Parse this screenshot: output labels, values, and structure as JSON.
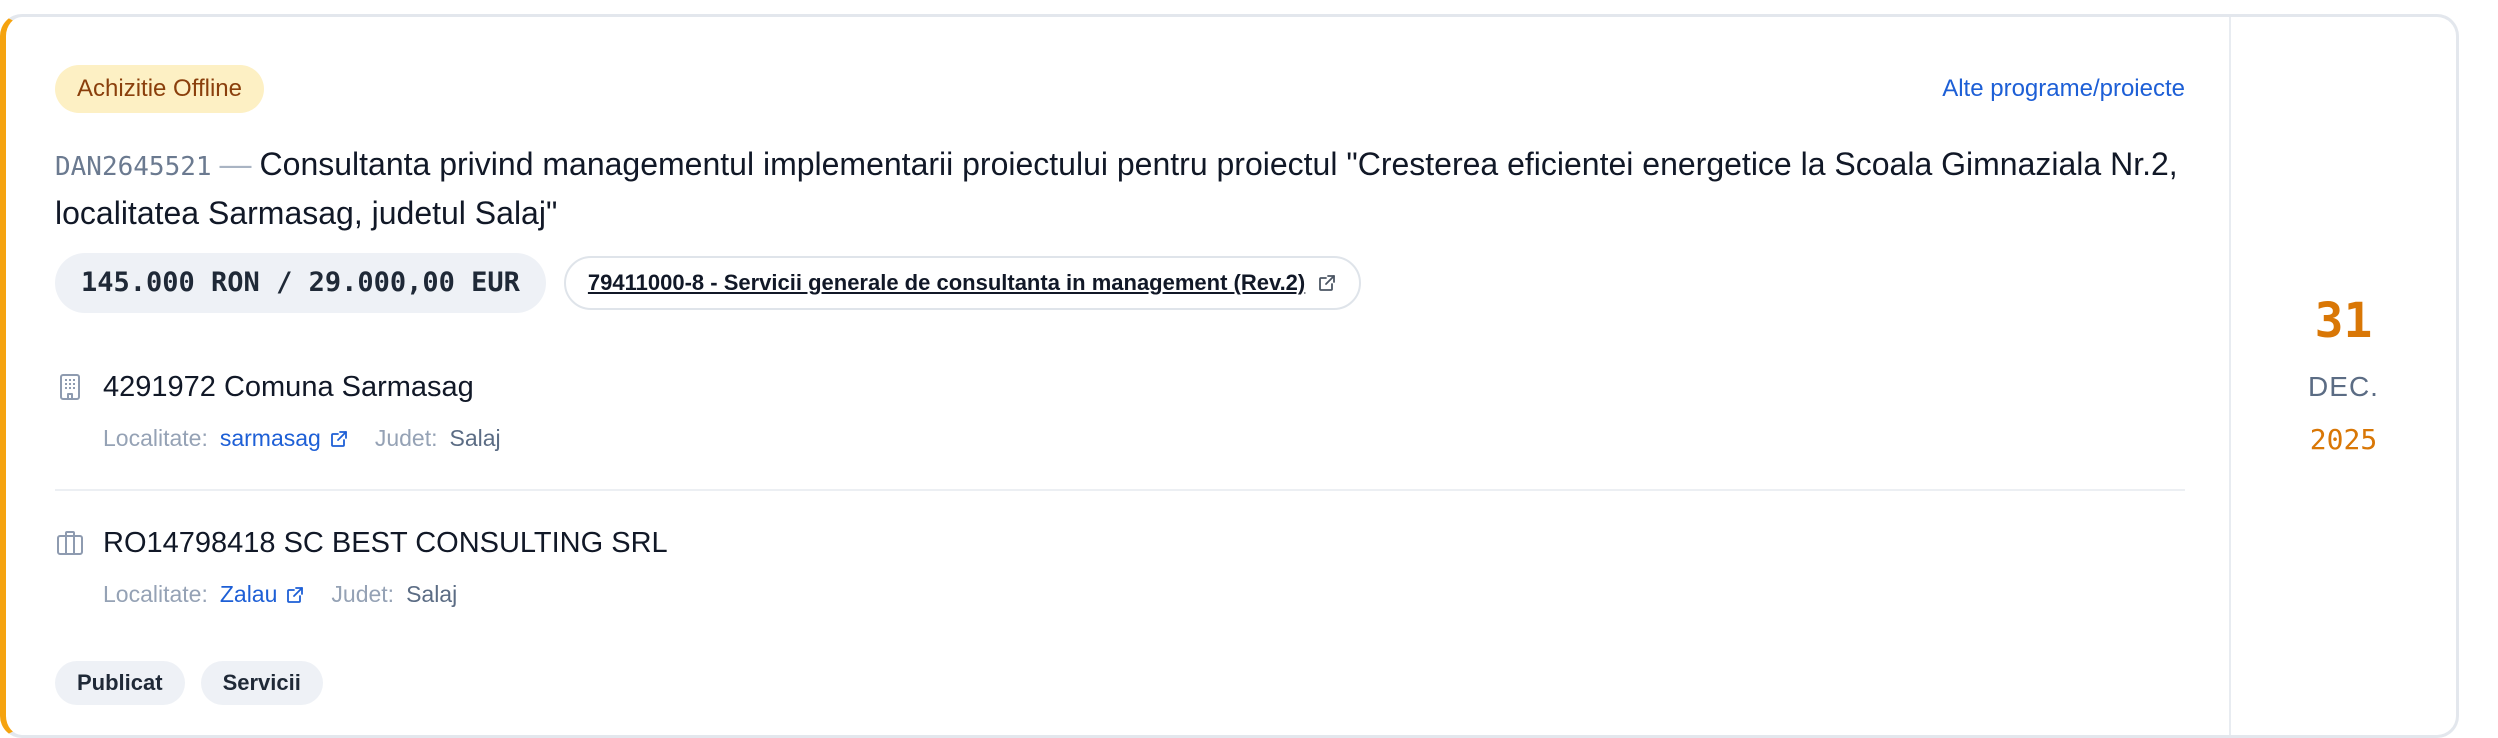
{
  "badge": {
    "label": "Achizitie Offline"
  },
  "header": {
    "other_link": "Alte programe/proiecte"
  },
  "title": {
    "code": "DAN2645521",
    "separator": "—",
    "text": "Consultanta privind managementul implementarii proiectului pentru proiectul \"Cresterea eficientei energetice la Scoala Gimnaziala Nr.2, localitatea Sarmasag, judetul Salaj\""
  },
  "price": {
    "label": "145.000 RON / 29.000,00 EUR"
  },
  "cpv": {
    "label": "79411000-8 - Servicii generale de consultanta in management (Rev.2)",
    "icon": "external-link-icon"
  },
  "authority": {
    "icon": "building-icon",
    "name": "4291972 Comuna Sarmasag",
    "localitate_label": "Localitate:",
    "localitate": "sarmasag",
    "judet_label": "Judet:",
    "judet": "Salaj"
  },
  "supplier": {
    "icon": "briefcase-icon",
    "name": "RO14798418 SC BEST CONSULTING SRL",
    "localitate_label": "Localitate:",
    "localitate": "Zalau",
    "judet_label": "Judet:",
    "judet": "Salaj"
  },
  "tags": [
    "Publicat",
    "Servicii"
  ],
  "date": {
    "day": "31",
    "month": "DEC.",
    "year": "2025"
  },
  "colors": {
    "accent": "#f5a30f",
    "date": "#d97706",
    "link": "#1d5fd6",
    "badge_bg": "#fdf0c4",
    "badge_text": "#8a3f0c"
  }
}
